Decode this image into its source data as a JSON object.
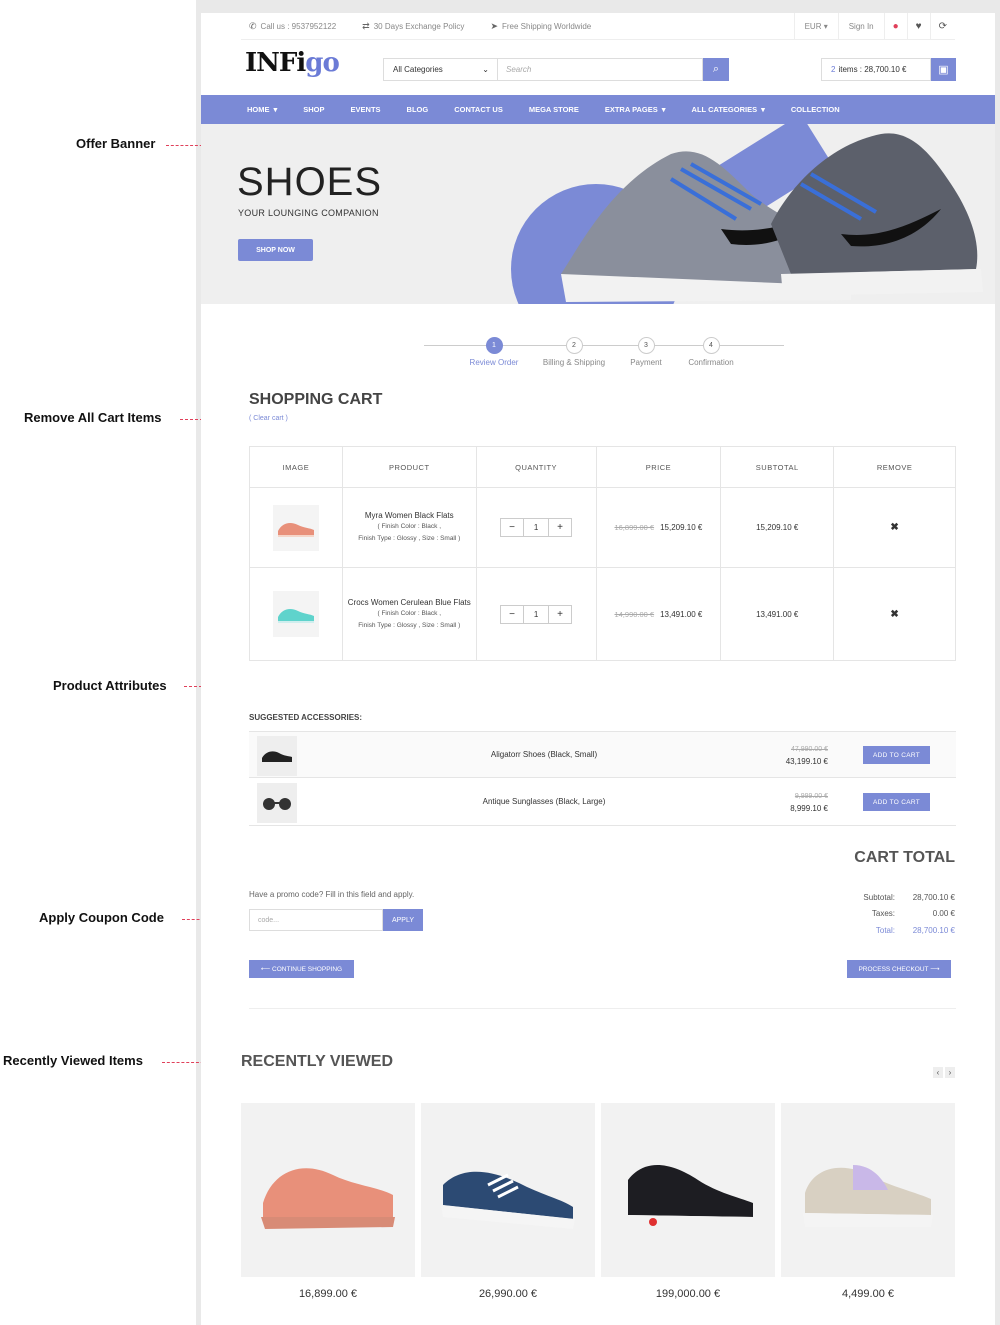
{
  "annotations": {
    "offer_banner": "Offer Banner",
    "remove_all": "Remove All Cart Items",
    "product_attributes": "Product Attributes",
    "apply_coupon": "Apply Coupon Code",
    "recently_viewed": "Recently Viewed Items"
  },
  "topbar": {
    "phone": "Call us : 9537952122",
    "exchange": "30 Days Exchange Policy",
    "shipping": "Free Shipping Worldwide",
    "currency": "EUR",
    "signin": "Sign In"
  },
  "header": {
    "logo_main": "INFi",
    "logo_accent": "go",
    "category_select": "All Categories",
    "search_placeholder": "Search",
    "cart_count": "2",
    "cart_summary": "items : 28,700.10 €"
  },
  "nav": [
    "HOME",
    "SHOP",
    "EVENTS",
    "BLOG",
    "CONTACT US",
    "MEGA STORE",
    "EXTRA PAGES",
    "ALL CATEGORIES",
    "COLLECTION"
  ],
  "banner": {
    "title": "SHOES",
    "subtitle": "YOUR LOUNGING COMPANION",
    "button": "SHOP NOW"
  },
  "steps": [
    {
      "num": "1",
      "label": "Review Order"
    },
    {
      "num": "2",
      "label": "Billing & Shipping"
    },
    {
      "num": "3",
      "label": "Payment"
    },
    {
      "num": "4",
      "label": "Confirmation"
    }
  ],
  "cart": {
    "title": "SHOPPING CART",
    "clear": "( Clear cart )",
    "columns": [
      "IMAGE",
      "PRODUCT",
      "QUANTITY",
      "PRICE",
      "SUBTOTAL",
      "REMOVE"
    ],
    "rows": [
      {
        "name": "Myra Women Black Flats",
        "attr1": "Finish Color : Black ,",
        "attr2": "Finish Type : Glossy , Size : Small",
        "qty": "1",
        "old_price": "16,899.00 €",
        "price": "15,209.10 €",
        "subtotal": "15,209.10 €"
      },
      {
        "name": "Crocs Women Cerulean Blue Flats",
        "attr1": "Finish Color : Black ,",
        "attr2": "Finish Type : Glossy , Size : Small",
        "qty": "1",
        "old_price": "14,990.00 €",
        "price": "13,491.00 €",
        "subtotal": "13,491.00 €"
      }
    ]
  },
  "suggested": {
    "title": "SUGGESTED ACCESSORIES:",
    "items": [
      {
        "name": "Aligatorr Shoes (Black, Small)",
        "old": "47,990.00 €",
        "price": "43,199.10 €",
        "button": "ADD TO CART"
      },
      {
        "name": "Antique Sunglasses (Black, Large)",
        "old": "9,999.00 €",
        "price": "8,999.10 €",
        "button": "ADD TO CART"
      }
    ]
  },
  "totals": {
    "title": "CART TOTAL",
    "subtotal_label": "Subtotal:",
    "subtotal": "28,700.10 €",
    "taxes_label": "Taxes:",
    "taxes": "0.00 €",
    "total_label": "Total:",
    "total": "28,700.10 €"
  },
  "promo": {
    "label": "Have a promo code? Fill in this field and apply.",
    "placeholder": "code...",
    "button": "APPLY"
  },
  "actions": {
    "continue": "⟵ CONTINUE SHOPPING",
    "checkout": "PROCESS CHECKOUT ⟶"
  },
  "recent": {
    "title": "RECENTLY VIEWED",
    "prices": [
      "16,899.00 €",
      "26,990.00 €",
      "199,000.00 €",
      "4,499.00 €"
    ]
  },
  "colors": {
    "accent": "#7b8ad6",
    "annotation": "#e0405a"
  }
}
